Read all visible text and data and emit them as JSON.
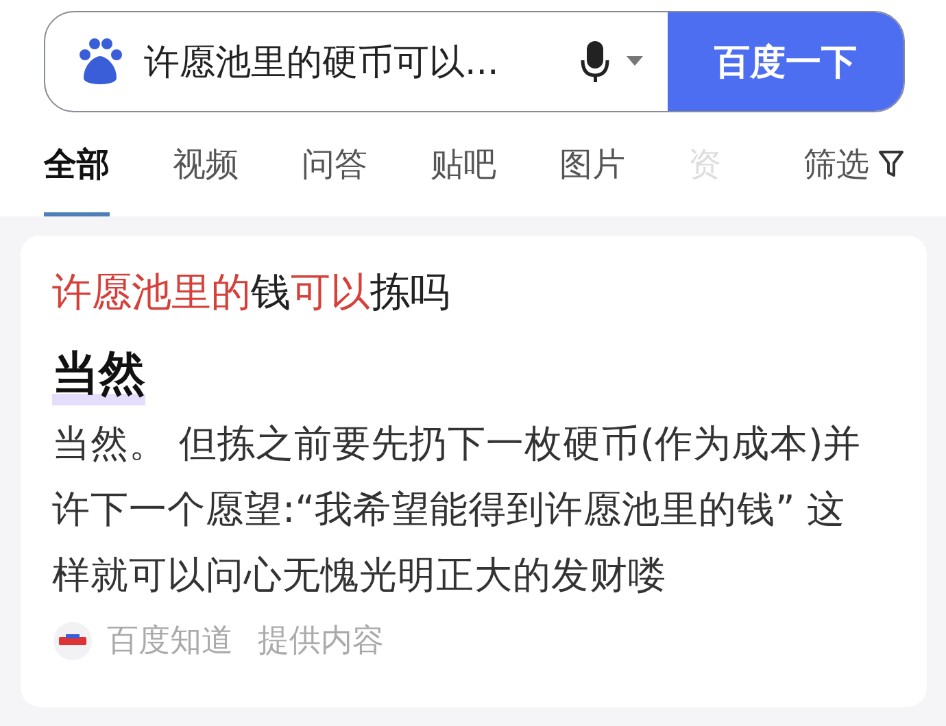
{
  "search": {
    "value": "许愿池里的硬币可以...",
    "button": "百度一下"
  },
  "tabs": [
    {
      "label": "全部",
      "selected": true,
      "faded": false
    },
    {
      "label": "视频",
      "selected": false,
      "faded": false
    },
    {
      "label": "问答",
      "selected": false,
      "faded": false
    },
    {
      "label": "贴吧",
      "selected": false,
      "faded": false
    },
    {
      "label": "图片",
      "selected": false,
      "faded": false
    },
    {
      "label": "资",
      "selected": false,
      "faded": true
    }
  ],
  "filter": "筛选",
  "result": {
    "title": [
      {
        "text": "许愿池里的",
        "highlight": true
      },
      {
        "text": "钱",
        "highlight": false
      },
      {
        "text": "可以",
        "highlight": true
      },
      {
        "text": "拣吗",
        "highlight": false
      }
    ],
    "answer": "当然",
    "body": "当然。 但拣之前要先扔下一枚硬币(作为成本)并许下一个愿望:“我希望能得到许愿池里的钱” 这样就可以问心无愧光明正大的发财喽",
    "source": "百度知道",
    "provider": "提供内容"
  }
}
